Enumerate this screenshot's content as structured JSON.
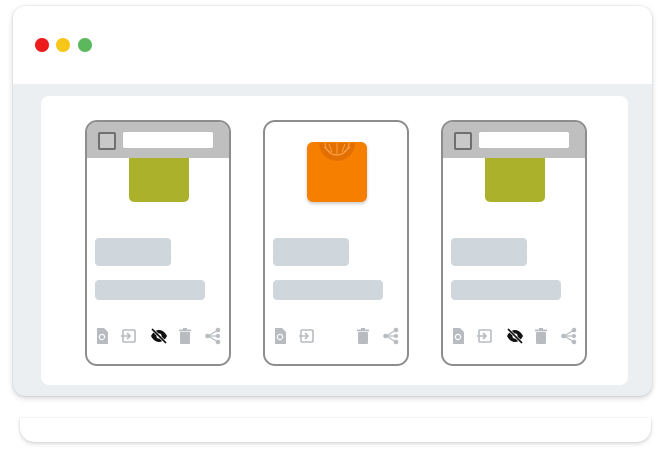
{
  "window": {
    "controls": [
      {
        "name": "close",
        "color": "#ec1c1c"
      },
      {
        "name": "minimize",
        "color": "#f6c719"
      },
      {
        "name": "maximize",
        "color": "#5cb85c"
      }
    ]
  },
  "cards": [
    {
      "thumbnail_color": "#abb12a",
      "selected": false,
      "visibility_icon": "eye-off-icon"
    },
    {
      "thumbnail_color": "#f77f00",
      "selected": false,
      "visibility_icon": null
    },
    {
      "thumbnail_color": "#abb12a",
      "selected": false,
      "visibility_icon": "eye-off-icon"
    }
  ],
  "card_actions": [
    "preview-icon",
    "move-icon",
    "eye-off-icon",
    "delete-icon",
    "share-icon"
  ],
  "colors": {
    "placeholder": "#cfd6dc",
    "icon_muted": "#b8bcc0",
    "icon_active": "#111111"
  }
}
